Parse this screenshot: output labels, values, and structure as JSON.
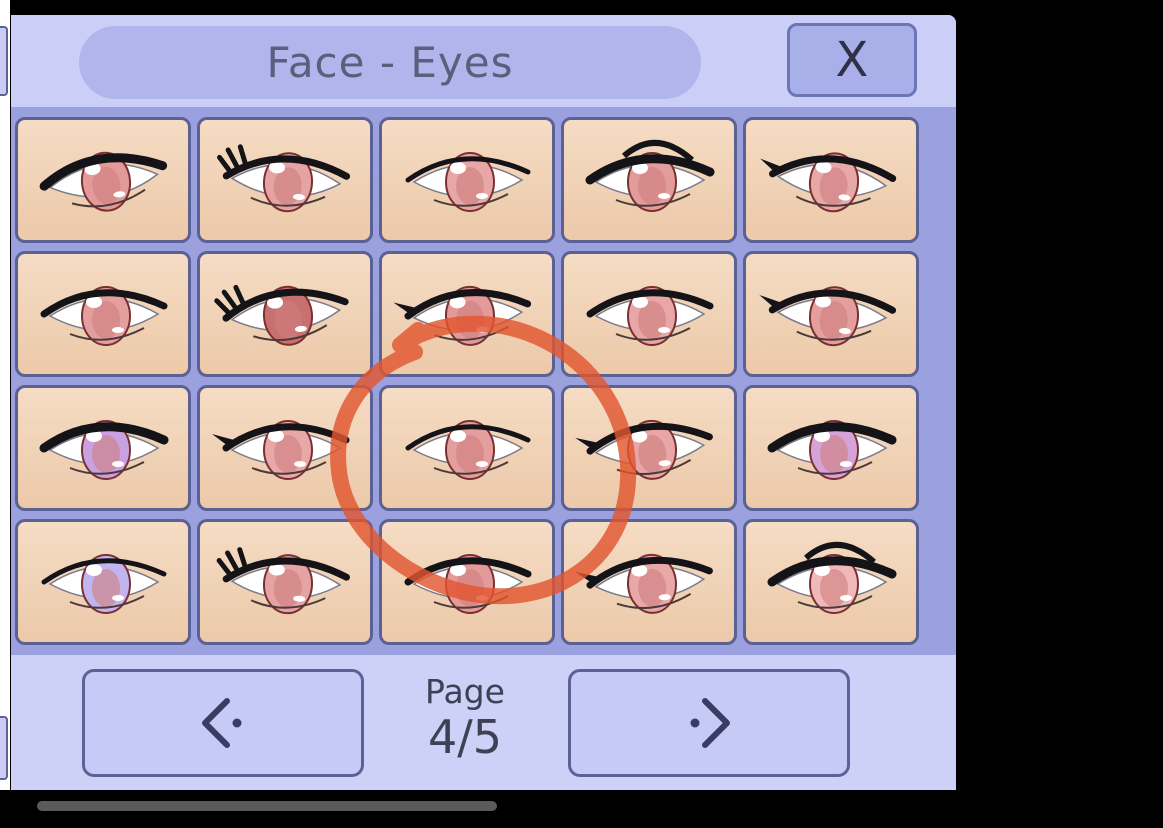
{
  "panel": {
    "title": "Face - Eyes",
    "close_label": "X"
  },
  "eye_options": [
    {
      "name": "eye-option-1"
    },
    {
      "name": "eye-option-2"
    },
    {
      "name": "eye-option-3"
    },
    {
      "name": "eye-option-4"
    },
    {
      "name": "eye-option-5"
    },
    {
      "name": "eye-option-6"
    },
    {
      "name": "eye-option-7"
    },
    {
      "name": "eye-option-8"
    },
    {
      "name": "eye-option-9"
    },
    {
      "name": "eye-option-10"
    },
    {
      "name": "eye-option-11"
    },
    {
      "name": "eye-option-12"
    },
    {
      "name": "eye-option-13"
    },
    {
      "name": "eye-option-14"
    },
    {
      "name": "eye-option-15"
    },
    {
      "name": "eye-option-16"
    },
    {
      "name": "eye-option-17"
    },
    {
      "name": "eye-option-18"
    },
    {
      "name": "eye-option-19"
    },
    {
      "name": "eye-option-20"
    }
  ],
  "pagination": {
    "label": "Page",
    "current": "4/5",
    "prev_icon": "chevron-left-icon",
    "next_icon": "chevron-right-icon"
  },
  "colors": {
    "iris": "#e8a2a2",
    "iris_dark": "#b35c5c",
    "lash": "#111111",
    "annotation": "#e0552f"
  }
}
